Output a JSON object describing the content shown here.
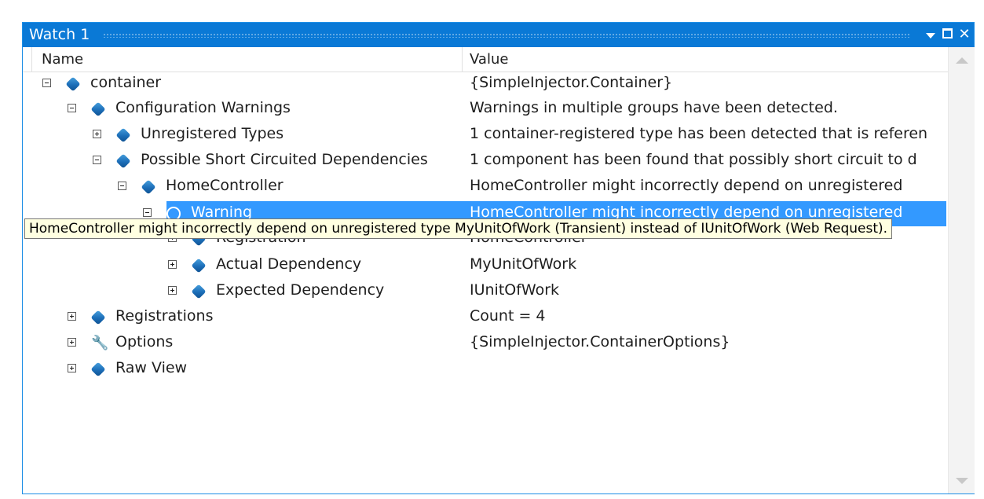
{
  "window": {
    "title": "Watch 1"
  },
  "columns": {
    "name": "Name",
    "value": "Value"
  },
  "rows": [
    {
      "name": "container",
      "value": "{SimpleInjector.Container}",
      "expander": "minus",
      "icon": "object-icon"
    },
    {
      "name": "Configuration Warnings",
      "value": "Warnings in multiple groups have been detected.",
      "expander": "minus",
      "icon": "object-icon"
    },
    {
      "name": "Unregistered Types",
      "value": "1 container-registered type has been detected that is referen",
      "expander": "plus",
      "icon": "object-icon"
    },
    {
      "name": "Possible Short Circuited Dependencies",
      "value": "1 component has been found that possibly short circuit to d",
      "expander": "minus",
      "icon": "object-icon"
    },
    {
      "name": "HomeController",
      "value": "HomeController might incorrectly depend on unregistered",
      "expander": "minus",
      "icon": "object-icon"
    },
    {
      "name": "Warning",
      "value": "HomeController might incorrectly depend on unregistered",
      "expander": "minus",
      "icon": "warning-icon",
      "selected": true
    },
    {
      "name": "Registration",
      "value": "HomeController",
      "expander": "plus",
      "icon": "object-icon"
    },
    {
      "name": "Actual Dependency",
      "value": "MyUnitOfWork",
      "expander": "plus",
      "icon": "object-icon"
    },
    {
      "name": "Expected Dependency",
      "value": "IUnitOfWork",
      "expander": "plus",
      "icon": "object-icon"
    },
    {
      "name": "Registrations",
      "value": "Count = 4",
      "expander": "plus",
      "icon": "object-icon"
    },
    {
      "name": "Options",
      "value": "{SimpleInjector.ContainerOptions}",
      "expander": "plus",
      "icon": "wrench-icon"
    },
    {
      "name": "Raw View",
      "value": "",
      "expander": "plus",
      "icon": "object-icon"
    }
  ],
  "tooltip": {
    "text": "HomeController might incorrectly depend on unregistered type MyUnitOfWork (Transient) instead of IUnitOfWork (Web Request)."
  },
  "colors": {
    "titlebar": "#0a79d6",
    "selection": "#3399ff",
    "tooltip_bg": "#ffffe1"
  }
}
